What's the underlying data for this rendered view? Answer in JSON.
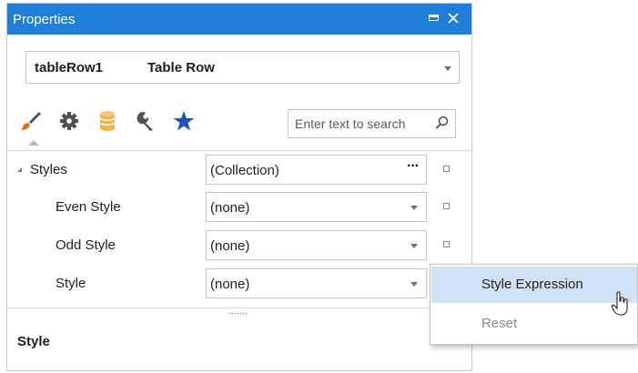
{
  "window": {
    "title": "Properties"
  },
  "object_selector": {
    "name": "tableRow1",
    "type": "Table Row"
  },
  "tabs": [
    {
      "icon": "paintbrush-icon",
      "label": "Appearance",
      "active": true
    },
    {
      "icon": "gear-icon",
      "label": "Behavior"
    },
    {
      "icon": "database-icon",
      "label": "Data"
    },
    {
      "icon": "wrench-icon",
      "label": "Layout"
    },
    {
      "icon": "star-icon",
      "label": "Favorites"
    }
  ],
  "search": {
    "placeholder": "Enter text to search"
  },
  "properties": [
    {
      "label": "Styles",
      "value": "(Collection)",
      "editor": "ellipsis",
      "expandable": true
    },
    {
      "label": "Even Style",
      "value": "(none)",
      "editor": "dropdown"
    },
    {
      "label": "Odd Style",
      "value": "(none)",
      "editor": "dropdown"
    },
    {
      "label": "Style",
      "value": "(none)",
      "editor": "dropdown"
    }
  ],
  "description": {
    "title": "Style"
  },
  "context_menu": {
    "items": [
      {
        "label": "Style Expression",
        "state": "highlighted"
      },
      {
        "label": "Reset",
        "state": "disabled"
      }
    ]
  },
  "colors": {
    "titlebar": "#1f7fd8",
    "highlight": "#cfe2f6",
    "brush": "#e06c1c",
    "database": "#f0b44c",
    "star": "#1c57b8"
  }
}
